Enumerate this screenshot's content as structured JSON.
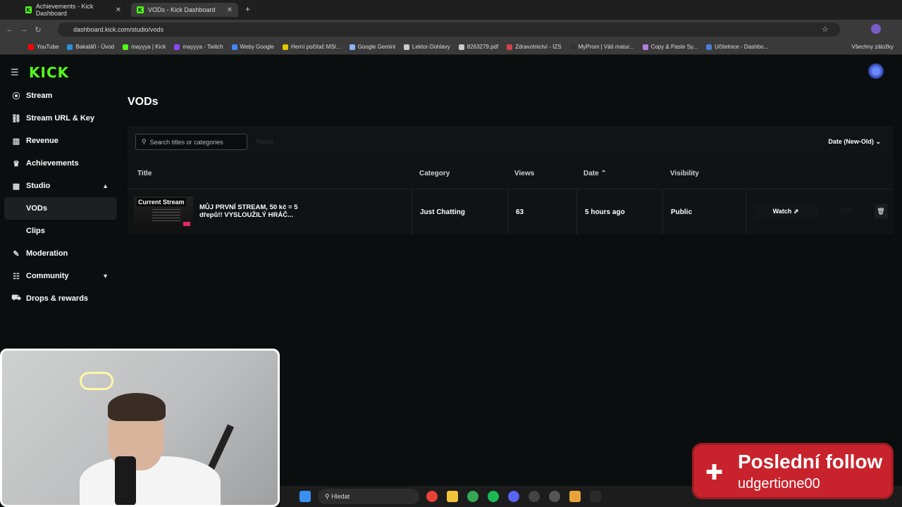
{
  "browser": {
    "tabs": [
      {
        "label": "Achievements - Kick Dashboard"
      },
      {
        "label": "VODs - Kick Dashboard"
      }
    ],
    "url": "dashboard.kick.com/studio/vods",
    "bookmarks": [
      {
        "label": "YouTube",
        "color": "#ff0000"
      },
      {
        "label": "Bakaláři - Úvod",
        "color": "#2a8fd9"
      },
      {
        "label": "mayyya | Kick",
        "color": "#53fc18"
      },
      {
        "label": "mayyya - Twitch",
        "color": "#9146ff"
      },
      {
        "label": "Weby Google",
        "color": "#4285f4"
      },
      {
        "label": "Herní počítač MSI...",
        "color": "#e8c400"
      },
      {
        "label": "Google Gemini",
        "color": "#8ab4f8"
      },
      {
        "label": "Lektor-Dohlavy",
        "color": "#cccccc"
      },
      {
        "label": "8263279.pdf",
        "color": "#cccccc"
      },
      {
        "label": "Zdravotnictví - IZS",
        "color": "#d0424a"
      },
      {
        "label": "MyProm | Váš matur...",
        "color": "#333333"
      },
      {
        "label": "Copy & Paste Sy...",
        "color": "#b37fe0"
      },
      {
        "label": "Učitelnice - Dashbo...",
        "color": "#4a7fd9"
      }
    ],
    "all_bookmarks": "Všechny záložky"
  },
  "app": {
    "logo": "KICK",
    "sidebar": [
      {
        "label": "Stream",
        "icon": "((·))"
      },
      {
        "label": "Stream URL & Key",
        "icon": "🔗"
      },
      {
        "label": "Revenue",
        "icon": "▥"
      },
      {
        "label": "Achievements",
        "icon": "🏆"
      },
      {
        "label": "Studio",
        "icon": "▦"
      },
      {
        "label": "VODs"
      },
      {
        "label": "Clips"
      },
      {
        "label": "Moderation",
        "icon": "🔧"
      },
      {
        "label": "Community",
        "icon": "👥"
      },
      {
        "label": "Drops & rewards",
        "icon": "🎁"
      }
    ],
    "page_title": "VODs",
    "search_placeholder": "Search titles or categories",
    "reset_label": "Reset",
    "sort_label": "Date (New-Old)",
    "columns": {
      "title": "Title",
      "category": "Category",
      "views": "Views",
      "date": "Date",
      "visibility": "Visibility"
    },
    "vods": [
      {
        "badge": "Current Stream",
        "title": "MŮJ PRVNÍ STREAM, 50 kč = 5 dřepů!! VYSLOUŽILÝ HRÁČ...",
        "category": "Just Chatting",
        "views": "63",
        "date": "5 hours ago",
        "visibility": "Public",
        "watch_label": "Watch",
        "edit_label": "Edit"
      }
    ]
  },
  "taskbar": {
    "search_label": "Hledat"
  },
  "follow_alert": {
    "title": "Poslední follow",
    "name": "udgertione00"
  }
}
